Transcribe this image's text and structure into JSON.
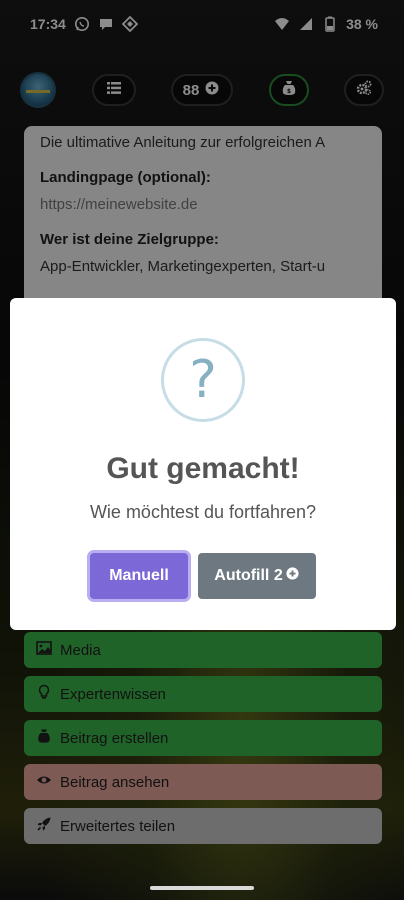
{
  "status_bar": {
    "time": "17:34",
    "battery": "38 %",
    "icons": [
      "whatsapp-icon",
      "chat-bubble-icon",
      "diamond-app-icon",
      "wifi-icon",
      "signal-icon",
      "battery-icon"
    ]
  },
  "topnav": {
    "credits": "88",
    "icons": [
      "avatar",
      "list-icon",
      "plus-circle-icon",
      "money-bag-icon",
      "settings-gears-icon"
    ]
  },
  "card": {
    "headline": "Die ultimative Anleitung zur erfolgreichen A",
    "landing_label": "Landingpage (optional):",
    "landing_value": "https://meinewebsite.de",
    "audience_label": "Wer ist deine Zielgruppe:",
    "audience_value": "App-Entwickler, Marketingexperten, Start-u"
  },
  "actions": {
    "media": "Media",
    "expert": "Expertenwissen",
    "create": "Beitrag erstellen",
    "view": "Beitrag ansehen",
    "share": "Erweitertes teilen"
  },
  "modal": {
    "icon": "?",
    "title": "Gut gemacht!",
    "text": "Wie möchtest du fortfahren?",
    "manual_label": "Manuell",
    "autofill_label": "Autofill 2"
  },
  "colors": {
    "green": "#3ab54a",
    "pink": "#e6a49a",
    "gray": "#c7c7c7",
    "primary_button": "#7d68d8",
    "secondary_button": "#6e7880"
  }
}
